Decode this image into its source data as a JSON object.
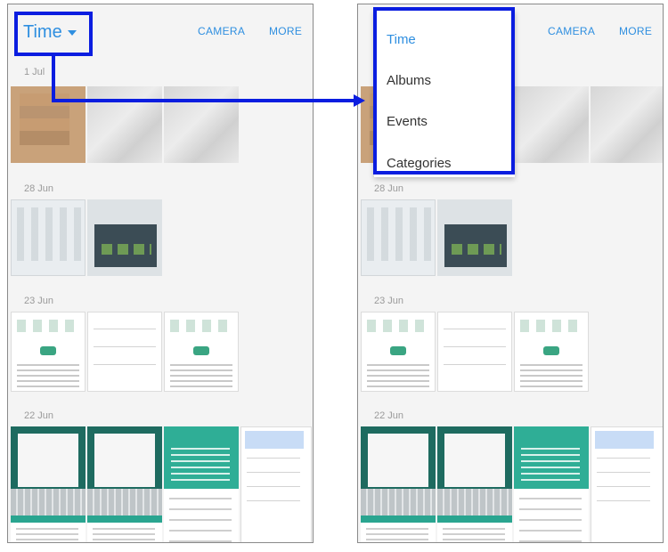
{
  "colors": {
    "accent": "#2f8fe0",
    "annotation": "#0a1de0",
    "teal": "#2fae96"
  },
  "left_screen": {
    "view_selector": "Time",
    "actions": {
      "camera": "CAMERA",
      "more": "MORE"
    },
    "sections": [
      {
        "date": "1 Jul"
      },
      {
        "date": "28 Jun"
      },
      {
        "date": "23 Jun"
      },
      {
        "date": "22 Jun"
      }
    ]
  },
  "right_screen": {
    "actions": {
      "camera": "CAMERA",
      "more": "MORE"
    },
    "menu": {
      "items": [
        {
          "label": "Time",
          "selected": true
        },
        {
          "label": "Albums",
          "selected": false
        },
        {
          "label": "Events",
          "selected": false
        },
        {
          "label": "Categories",
          "selected": false
        }
      ]
    },
    "sections": [
      {
        "date": "28 Jun"
      },
      {
        "date": "23 Jun"
      },
      {
        "date": "22 Jun"
      }
    ]
  },
  "icons": {
    "dropdown": "caret-down-icon",
    "connector": "arrow-right-icon"
  }
}
